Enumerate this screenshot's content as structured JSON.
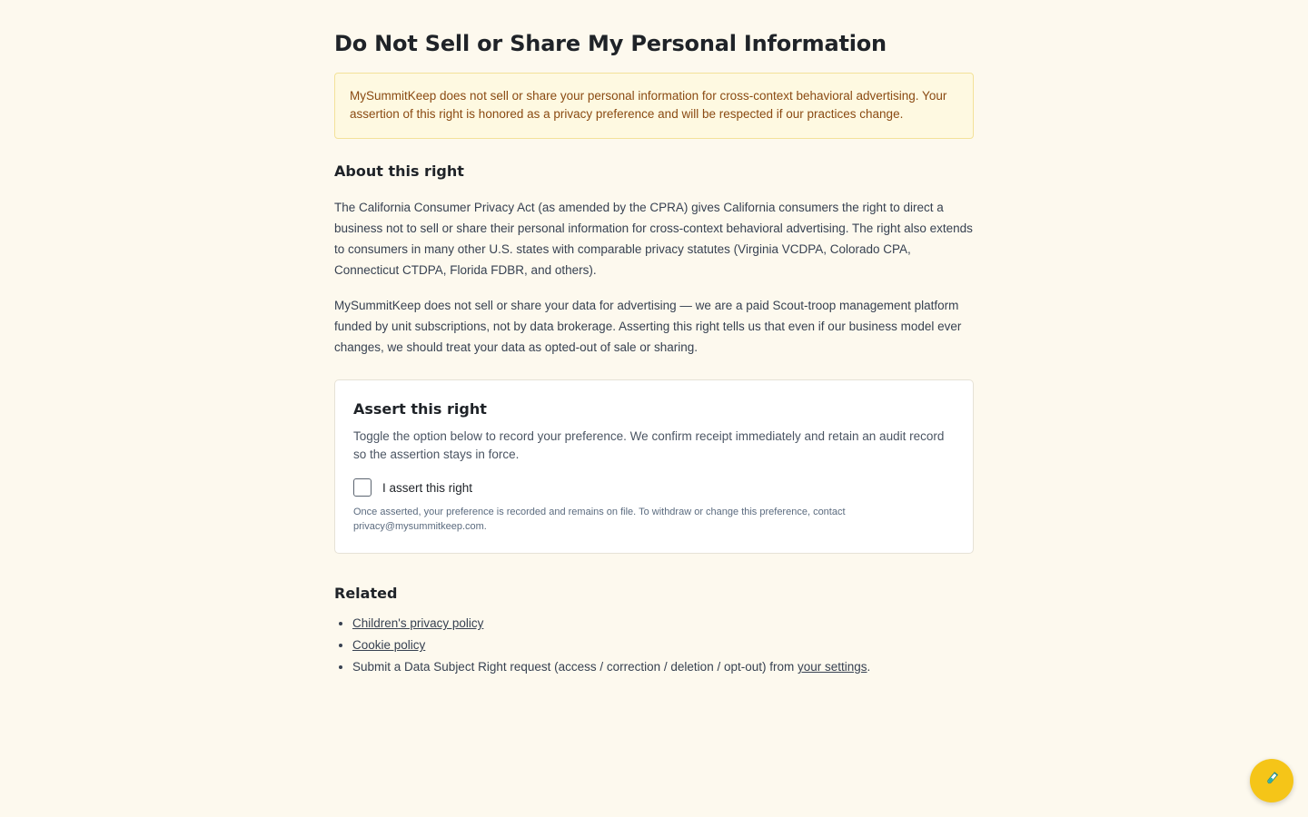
{
  "page": {
    "title": "Do Not Sell or Share My Personal Information"
  },
  "notice": {
    "text": "MySummitKeep does not sell or share your personal information for cross-context behavioral advertising. Your assertion of this right is honored as a privacy preference and will be respected if our practices change."
  },
  "about": {
    "heading": "About this right",
    "paragraph1": "The California Consumer Privacy Act (as amended by the CPRA) gives California consumers the right to direct a business not to sell or share their personal information for cross-context behavioral advertising. The right also extends to consumers in many other U.S. states with comparable privacy statutes (Virginia VCDPA, Colorado CPA, Connecticut CTDPA, Florida FDBR, and others).",
    "paragraph2": "MySummitKeep does not sell or share your data for advertising — we are a paid Scout-troop management platform funded by unit subscriptions, not by data brokerage. Asserting this right tells us that even if our business model ever changes, we should treat your data as opted-out of sale or sharing."
  },
  "assert": {
    "heading": "Assert this right",
    "description": "Toggle the option below to record your preference. We confirm receipt immediately and retain an audit record so the assertion stays in force.",
    "checkbox_label": "I assert this right",
    "checked": false,
    "fine_print": "Once asserted, your preference is recorded and remains on file. To withdraw or change this preference, contact privacy@mysummitkeep.com."
  },
  "related": {
    "heading": "Related",
    "link1": "Children's privacy policy",
    "link2": "Cookie policy",
    "item3_prefix": "Submit a Data Subject Right request (access / correction / deletion / opt-out) from ",
    "item3_link": "your settings",
    "item3_suffix": "."
  },
  "fab": {
    "icon": "test-tube-icon"
  },
  "colors": {
    "background": "#fdf9ee",
    "notice_bg": "#fef9e1",
    "notice_text": "#8a4a12",
    "fab": "#f5c518"
  }
}
